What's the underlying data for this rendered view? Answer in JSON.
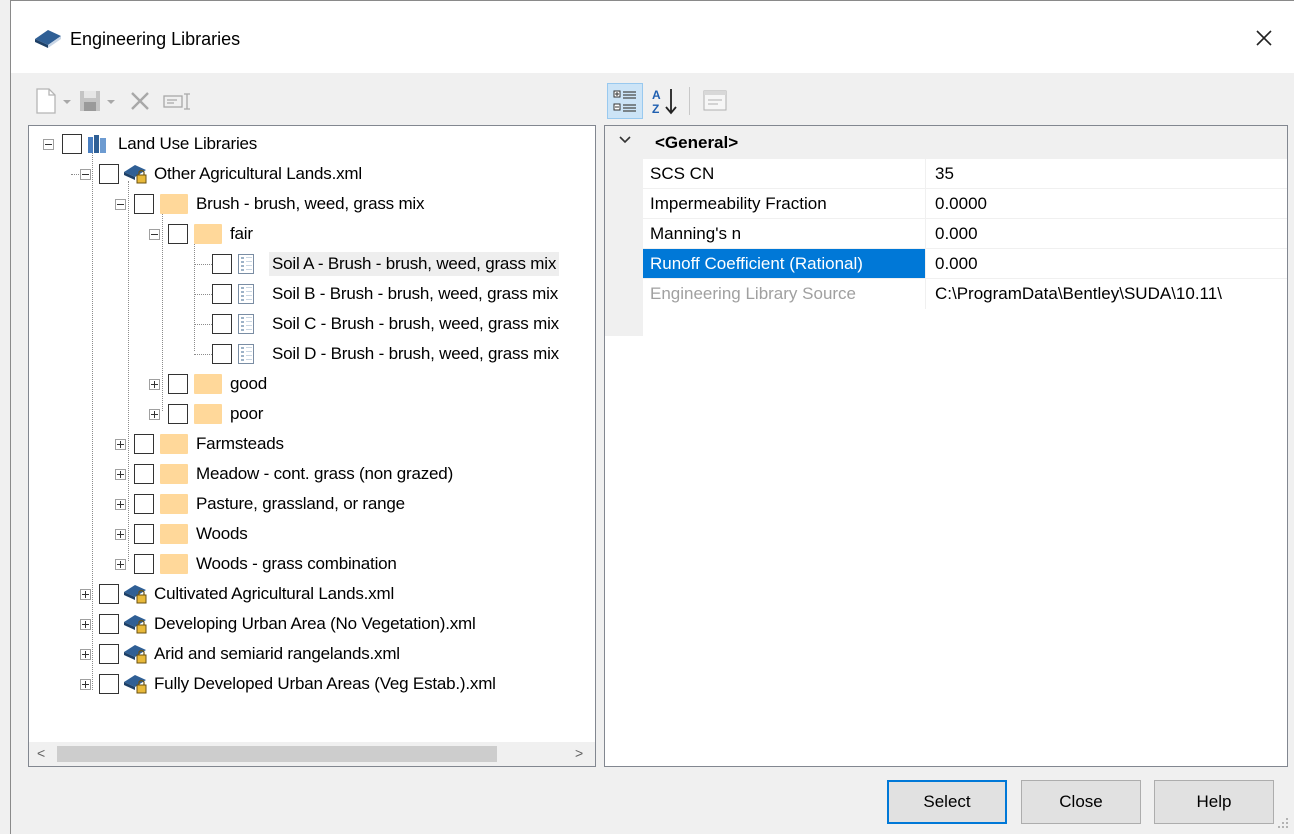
{
  "window": {
    "title": "Engineering Libraries",
    "close_glyph": "✕"
  },
  "left_toolbar": {
    "icons": [
      "new-icon",
      "dropdown-arrow-icon",
      "save-icon",
      "dropdown-arrow-icon",
      "delete-icon",
      "rename-icon"
    ]
  },
  "tree": {
    "root": "Land Use Libraries",
    "libraries": [
      "Other Agricultural Lands.xml",
      "Cultivated Agricultural Lands.xml",
      "Developing Urban Area (No Vegetation).xml",
      "Arid and semiarid rangelands.xml",
      "Fully Developed Urban Areas (Veg Estab.).xml"
    ],
    "categories": [
      "Brush - brush, weed, grass mix",
      "Farmsteads",
      "Meadow - cont. grass (non grazed)",
      "Pasture, grassland, or range",
      "Woods",
      "Woods - grass combination"
    ],
    "conditions": [
      "fair",
      "good",
      "poor"
    ],
    "entries": [
      "Soil A - Brush - brush, weed, grass mix",
      "Soil B - Brush - brush, weed, grass mix",
      "Soil C - Brush - brush, weed, grass mix",
      "Soil D - Brush - brush, weed, grass mix"
    ],
    "selected_entry": "Soil A - Brush - brush, weed, grass mix"
  },
  "right_toolbar": {
    "icons": [
      "categorized-icon",
      "alphabetical-sort-icon",
      "property-pages-icon"
    ]
  },
  "properties": {
    "category": "<General>",
    "rows": [
      {
        "name": "SCS CN",
        "value": "35"
      },
      {
        "name": "Impermeability Fraction",
        "value": "0.0000"
      },
      {
        "name": "Manning's n",
        "value": "0.000"
      },
      {
        "name": "Runoff Coefficient (Rational)",
        "value": "0.000"
      },
      {
        "name": "Engineering Library Source",
        "value": "C:\\ProgramData\\Bentley\\SUDA\\10.11\\"
      }
    ],
    "selected_row": "Runoff Coefficient (Rational)"
  },
  "buttons": {
    "select": "Select",
    "close": "Close",
    "help": "Help"
  },
  "scrollbar": {
    "left_arrow": "<",
    "right_arrow": ">"
  },
  "colors": {
    "selection_blue": "#0078d7",
    "folder": "#ffd89a",
    "dialog_bg": "#f0f0f0"
  }
}
